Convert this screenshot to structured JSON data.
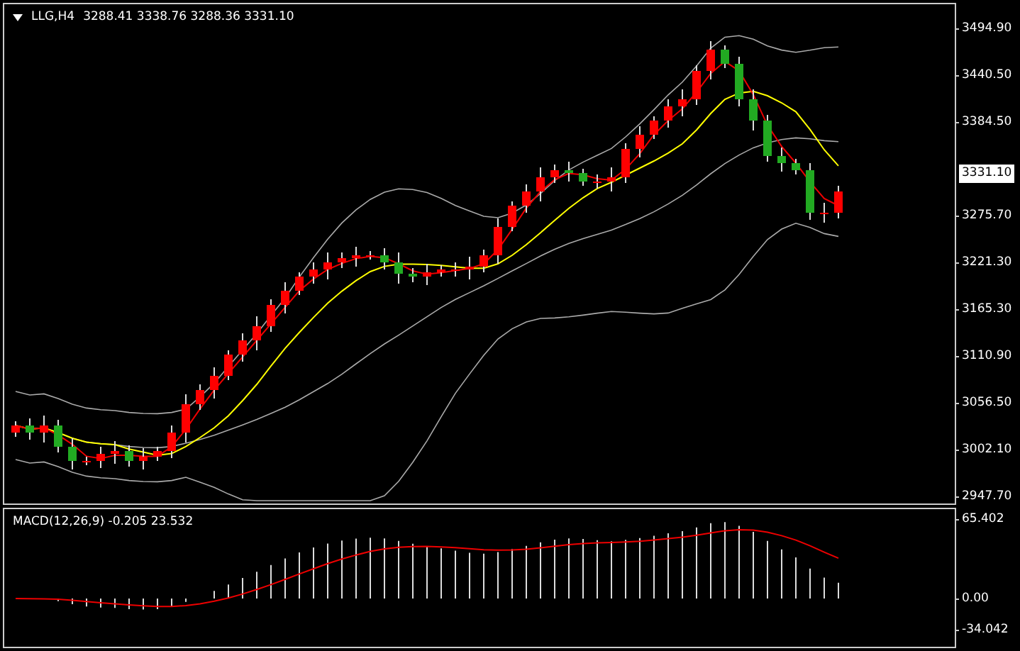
{
  "chart": {
    "symbol": "LLG,H4",
    "ohlc": "3288.41 3338.76 3288.36 3331.10"
  },
  "price_axis": {
    "ticks": [
      "3494.90",
      "3440.50",
      "3384.50",
      "3275.70",
      "3221.30",
      "3165.30",
      "3110.90",
      "3056.50",
      "3002.10",
      "2947.70"
    ],
    "current_price": "3331.10"
  },
  "macd": {
    "label": "MACD(12,26,9) -0.205 23.532",
    "axis_max": "65.402",
    "axis_zero": "0.00",
    "axis_min": "-34.042"
  }
}
